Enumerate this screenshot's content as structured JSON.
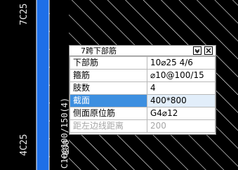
{
  "drawing": {
    "label_top": "7C25",
    "label_bottom": "4C25",
    "label_beam": "C10@100/150(4)",
    "label_size": "*800"
  },
  "colors": {
    "background": "#000000",
    "column_fill": "#1e6fe8",
    "hatch": "#ffffff",
    "selection": "#3d8fe0"
  },
  "panel": {
    "title": "7跨下部筋",
    "min_icon": "chevron-down-icon",
    "close_icon": "close-icon",
    "rows": [
      {
        "key": "下部筋",
        "value": "10⌀25 4/6"
      },
      {
        "key": "箍筋",
        "value": "⌀10@100/15"
      },
      {
        "key": "肢数",
        "value": "4"
      },
      {
        "key": "截面",
        "value": "400*800"
      },
      {
        "key": "侧面原位筋",
        "value": "G4⌀12"
      },
      {
        "key": "距左边线距离",
        "value": "200"
      }
    ]
  }
}
